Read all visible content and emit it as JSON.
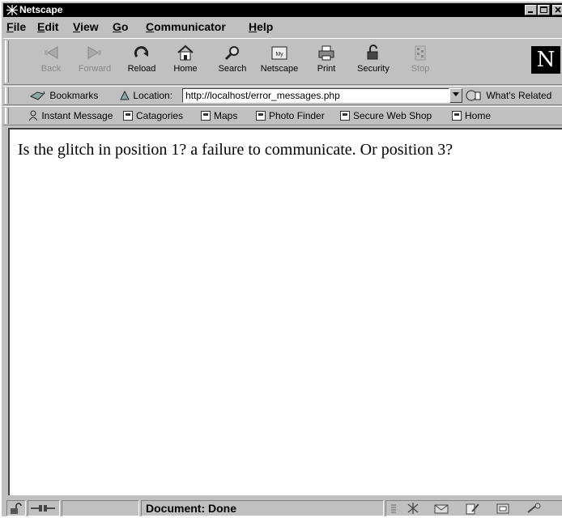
{
  "window": {
    "title": "Netscape"
  },
  "menu": [
    "File",
    "Edit",
    "View",
    "Go",
    "Communicator",
    "Help"
  ],
  "menu_accel": [
    "F",
    "E",
    "V",
    "G",
    "C",
    "H"
  ],
  "toolbar": {
    "back": "Back",
    "forward": "Forward",
    "reload": "Reload",
    "home": "Home",
    "search": "Search",
    "netscape": "Netscape",
    "print": "Print",
    "security": "Security",
    "stop": "Stop"
  },
  "brand_letter": "N",
  "location": {
    "bookmarks": "Bookmarks",
    "label": "Location:",
    "url": "http://localhost/error_messages.php",
    "whats_related": "What's Related"
  },
  "personal": {
    "instant_message": "Instant Message",
    "items": [
      "Catagories",
      "Maps",
      "Photo Finder",
      "Secure Web Shop",
      "Home"
    ]
  },
  "content": {
    "text": "Is the glitch in position 1? a failure to communicate. Or position 3?"
  },
  "status": {
    "text": "Document: Done"
  }
}
